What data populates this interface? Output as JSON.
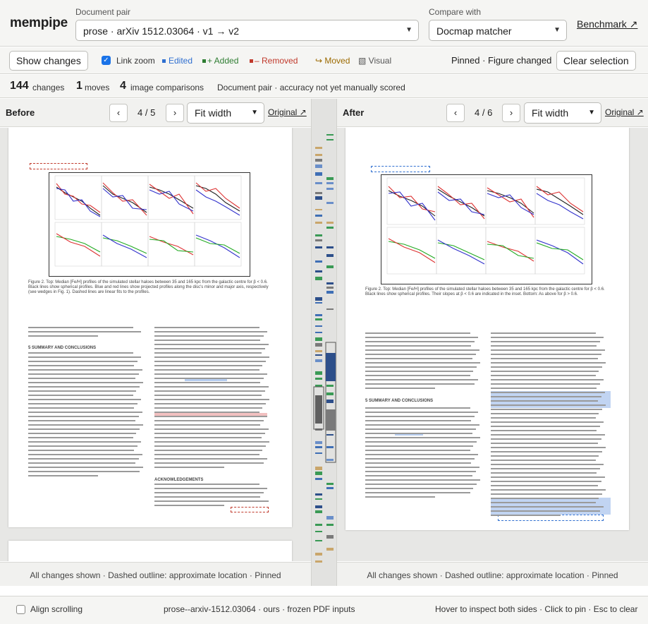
{
  "app": {
    "name": "mempipe"
  },
  "header": {
    "doc_pair_label": "Document pair",
    "doc_pair_value": "prose · arXiv 1512.03064 · v1 → v2",
    "compare_label": "Compare with",
    "compare_value": "Docmap matcher",
    "benchmark_link": "Benchmark ↗"
  },
  "toolbar": {
    "show_changes": "Show changes",
    "link_zoom_label": "Link zoom",
    "link_zoom_checked": true,
    "legend": [
      {
        "label": "Edited",
        "color": "#2f6fd0"
      },
      {
        "label": "+ Added",
        "color": "#2e7d32"
      },
      {
        "label": "– Removed",
        "color": "#c0392b"
      },
      {
        "label": "↪ Moved",
        "color": "#9c6a00"
      },
      {
        "label": "▧ Visual",
        "color": "#555555"
      }
    ],
    "pinned_status": "Pinned · Figure changed",
    "clear_selection": "Clear selection"
  },
  "stats": {
    "changes_count": "144",
    "changes_label": "changes",
    "moves_count": "1",
    "moves_label": "moves",
    "images_count": "4",
    "images_label": "image comparisons",
    "note": "Document pair · accuracy not yet manually scored"
  },
  "before": {
    "title": "Before",
    "prev": "‹",
    "next": "›",
    "page_indicator": "4 / 5",
    "zoom": "Fit width",
    "original_link": "Original ↗",
    "footer": "All changes shown · Dashed outline: approximate location · Pinned",
    "page": {
      "section_title": "5   SUMMARY AND CONCLUSIONS",
      "ack_title": "ACKNOWLEDGEMENTS",
      "caption": "Figure 2. Top: Median [Fe/H] profiles of the simulated stellar haloes between 35 and 165 kpc from the galactic centre for β < 0.6. Black lines show spherical profiles. Blue and red lines show projected profiles along the disc's minor and major axis, respectively (see wedges in Fig. 1). Dashed lines are linear fits to the profiles."
    }
  },
  "after": {
    "title": "After",
    "prev": "‹",
    "next": "›",
    "page_indicator": "4 / 6",
    "zoom": "Fit width",
    "original_link": "Original ↗",
    "footer": "All changes shown · Dashed outline: approximate location · Pinned",
    "page": {
      "section_title": "5   SUMMARY AND CONCLUSIONS",
      "caption": "Figure 2. Top: Median [Fe/H] profiles of the simulated stellar haloes between 35 and 165 kpc from the galactic centre for β < 0.6. Black lines show spherical profiles. Their slopes at β < 0.6 are indicated in the inset. Bottom: As above for β > 0.6."
    }
  },
  "footer": {
    "align_scrolling": "Align scrolling",
    "align_checked": false,
    "source": "prose--arxiv-1512.03064 · ours · frozen PDF inputs",
    "hint": "Hover to inspect both sides · Click to pin · Esc to clear"
  }
}
